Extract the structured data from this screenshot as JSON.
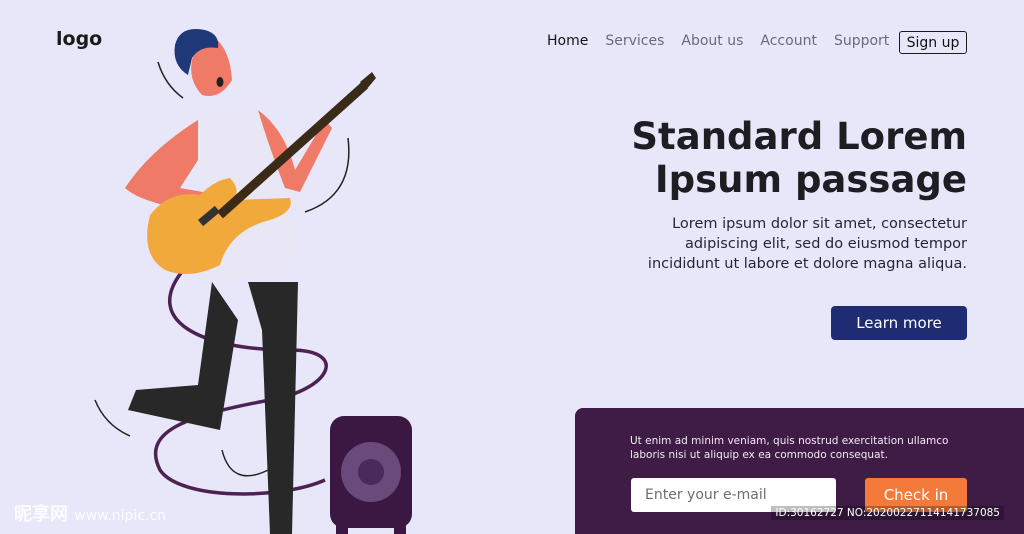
{
  "header": {
    "logo": "logo",
    "nav": [
      {
        "label": "Home",
        "active": true
      },
      {
        "label": "Services",
        "active": false
      },
      {
        "label": "About us",
        "active": false
      },
      {
        "label": "Account",
        "active": false
      },
      {
        "label": "Support",
        "active": false
      }
    ],
    "signup_label": "Sign up"
  },
  "hero": {
    "title_line1": "Standard Lorem",
    "title_line2": "Ipsum passage",
    "text_line1": "Lorem ipsum dolor sit amet, consectetur",
    "text_line2": "adipiscing elit, sed do eiusmod tempor",
    "text_line3": "incididunt ut labore et dolore magna aliqua.",
    "learn_more_label": "Learn more"
  },
  "subscribe": {
    "text_line1": "Ut enim ad minim veniam, quis nostrud exercitation ullamco",
    "text_line2": "laboris nisi ut aliquip ex ea commodo consequat.",
    "email_placeholder": "Enter your e-mail",
    "check_in_label": "Check in"
  },
  "watermark": {
    "left_brand": "昵享网",
    "left_url": "www.nipic.cn",
    "right_id": "ID:30162727 NO:20200227114141737085"
  },
  "colors": {
    "background": "#e8e7fa",
    "primary_button": "#1f2b73",
    "panel": "#3f1c46",
    "accent": "#f47a3c"
  }
}
